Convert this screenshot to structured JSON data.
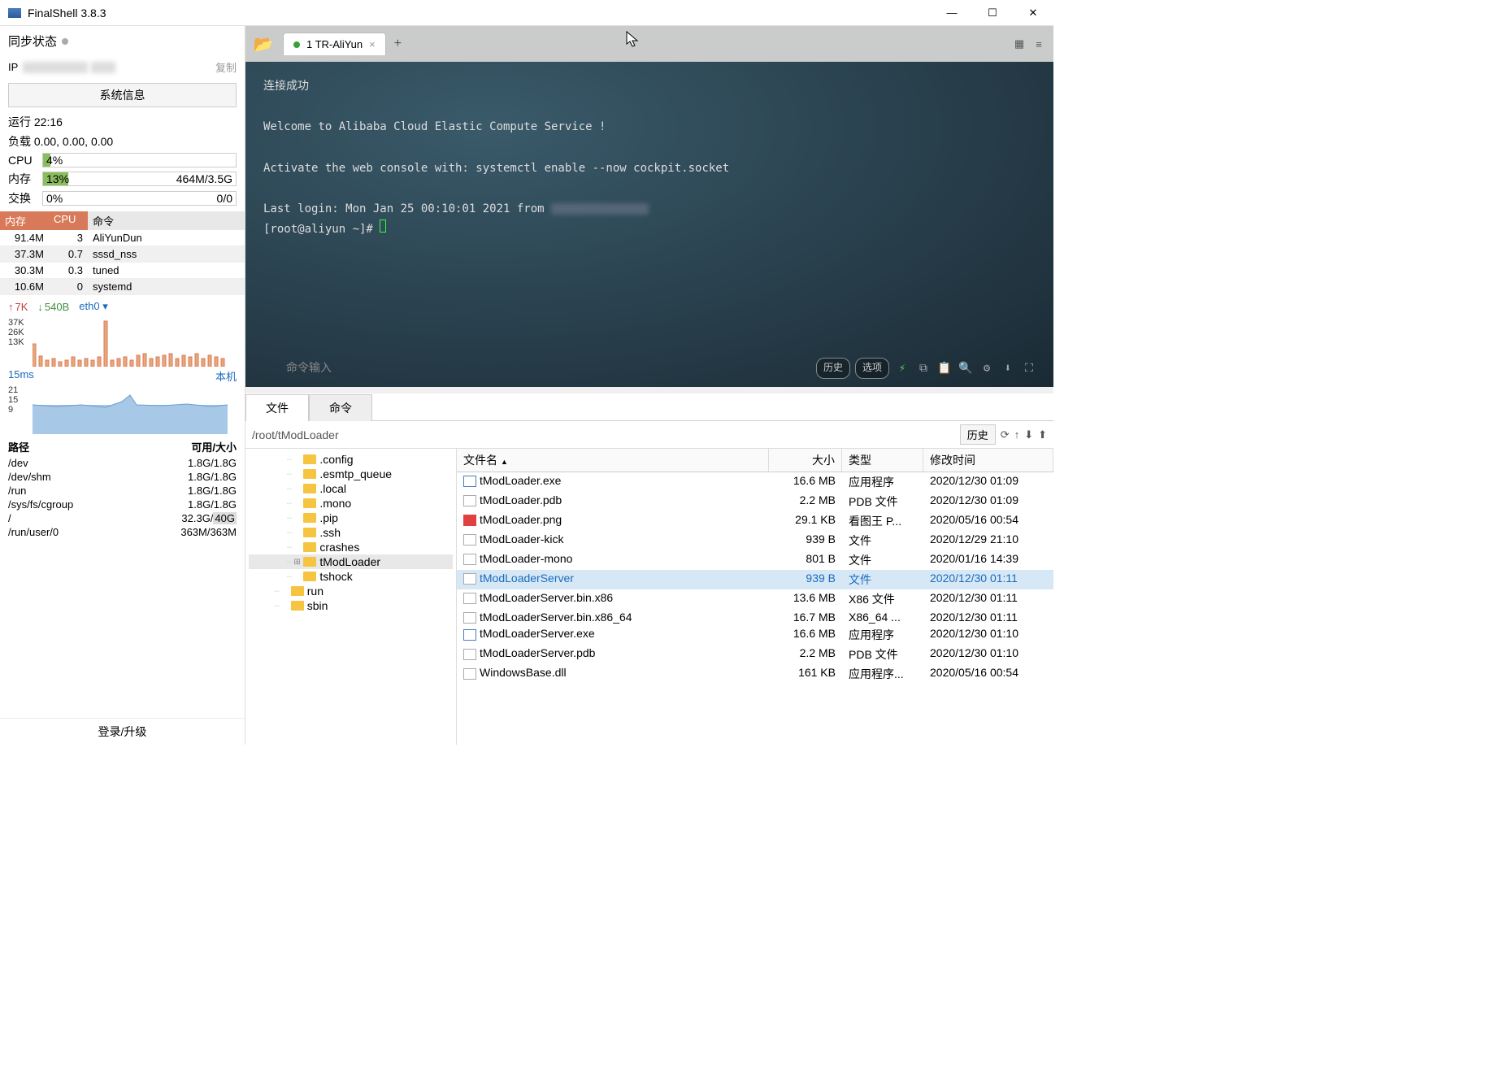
{
  "app": {
    "title": "FinalShell 3.8.3"
  },
  "titlebar": {
    "minimize": "—",
    "maximize": "☐",
    "close": "✕"
  },
  "left": {
    "sync_label": "同步状态",
    "ip_label": "IP",
    "copy": "复制",
    "sys_info": "系统信息",
    "uptime": "运行 22:16",
    "load": "负载 0.00, 0.00, 0.00",
    "cpu_label": "CPU",
    "cpu_pct": "4%",
    "mem_label": "内存",
    "mem_pct": "13%",
    "mem_text": "464M/3.5G",
    "swap_label": "交换",
    "swap_pct": "0%",
    "swap_text": "0/0",
    "proc_hdr": {
      "mem": "内存",
      "cpu": "CPU",
      "cmd": "命令"
    },
    "procs": [
      {
        "mem": "91.4M",
        "cpu": "3",
        "cmd": "AliYunDun"
      },
      {
        "mem": "37.3M",
        "cpu": "0.7",
        "cmd": "sssd_nss"
      },
      {
        "mem": "30.3M",
        "cpu": "0.3",
        "cmd": "tuned"
      },
      {
        "mem": "10.6M",
        "cpu": "0",
        "cmd": "systemd"
      }
    ],
    "net_up": "7K",
    "net_down": "540B",
    "net_if": "eth0 ▾",
    "net_axis": [
      "37K",
      "26K",
      "13K"
    ],
    "latency": "15ms",
    "latency_axis": [
      "21",
      "15",
      "9"
    ],
    "host_label": "本机",
    "disk_hdr": {
      "path": "路径",
      "usage": "可用/大小"
    },
    "disks": [
      {
        "path": "/dev",
        "usage": "1.8G/1.8G"
      },
      {
        "path": "/dev/shm",
        "usage": "1.8G/1.8G"
      },
      {
        "path": "/run",
        "usage": "1.8G/1.8G"
      },
      {
        "path": "/sys/fs/cgroup",
        "usage": "1.8G/1.8G"
      },
      {
        "path": "/",
        "usage": "32.3G/40G"
      },
      {
        "path": "/run/user/0",
        "usage": "363M/363M"
      }
    ],
    "login_upgrade": "登录/升级"
  },
  "tabs": {
    "active": "1 TR-AliYun",
    "add": "+"
  },
  "terminal": {
    "lines": [
      "连接成功",
      "",
      "Welcome to Alibaba Cloud Elastic Compute Service !",
      "",
      "Activate the web console with: systemctl enable --now cockpit.socket",
      "",
      "Last login: Mon Jan 25 00:10:01 2021 from "
    ],
    "prompt": "[root@aliyun ~]# ",
    "input_placeholder": "命令输入",
    "history_btn": "历史",
    "options_btn": "选项"
  },
  "bottom_tabs": {
    "files": "文件",
    "cmds": "命令"
  },
  "path_bar": {
    "path": "/root/tModLoader",
    "history": "历史"
  },
  "tree": [
    {
      "name": ".config",
      "indent": 3
    },
    {
      "name": ".esmtp_queue",
      "indent": 3
    },
    {
      "name": ".local",
      "indent": 3
    },
    {
      "name": ".mono",
      "indent": 3
    },
    {
      "name": ".pip",
      "indent": 3
    },
    {
      "name": ".ssh",
      "indent": 3
    },
    {
      "name": "crashes",
      "indent": 3
    },
    {
      "name": "tModLoader",
      "indent": 3,
      "selected": true,
      "expandable": true
    },
    {
      "name": "tshock",
      "indent": 3
    },
    {
      "name": "run",
      "indent": 2
    },
    {
      "name": "sbin",
      "indent": 2
    }
  ],
  "file_hdr": {
    "name": "文件名",
    "size": "大小",
    "type": "类型",
    "date": "修改时间"
  },
  "files": [
    {
      "name": "tModLoader.exe",
      "size": "16.6 MB",
      "type": "应用程序",
      "date": "2020/12/30 01:09",
      "icon": "exe"
    },
    {
      "name": "tModLoader.pdb",
      "size": "2.2 MB",
      "type": "PDB 文件",
      "date": "2020/12/30 01:09",
      "icon": "file"
    },
    {
      "name": "tModLoader.png",
      "size": "29.1 KB",
      "type": "看图王 P...",
      "date": "2020/05/16 00:54",
      "icon": "png"
    },
    {
      "name": "tModLoader-kick",
      "size": "939 B",
      "type": "文件",
      "date": "2020/12/29 21:10",
      "icon": "file"
    },
    {
      "name": "tModLoader-mono",
      "size": "801 B",
      "type": "文件",
      "date": "2020/01/16 14:39",
      "icon": "file"
    },
    {
      "name": "tModLoaderServer",
      "size": "939 B",
      "type": "文件",
      "date": "2020/12/30 01:11",
      "icon": "file",
      "selected": true
    },
    {
      "name": "tModLoaderServer.bin.x86",
      "size": "13.6 MB",
      "type": "X86 文件",
      "date": "2020/12/30 01:11",
      "icon": "file"
    },
    {
      "name": "tModLoaderServer.bin.x86_64",
      "size": "16.7 MB",
      "type": "X86_64 ...",
      "date": "2020/12/30 01:11",
      "icon": "file"
    },
    {
      "name": "tModLoaderServer.exe",
      "size": "16.6 MB",
      "type": "应用程序",
      "date": "2020/12/30 01:10",
      "icon": "exe"
    },
    {
      "name": "tModLoaderServer.pdb",
      "size": "2.2 MB",
      "type": "PDB 文件",
      "date": "2020/12/30 01:10",
      "icon": "file"
    },
    {
      "name": "WindowsBase.dll",
      "size": "161 KB",
      "type": "应用程序...",
      "date": "2020/05/16 00:54",
      "icon": "file"
    }
  ]
}
